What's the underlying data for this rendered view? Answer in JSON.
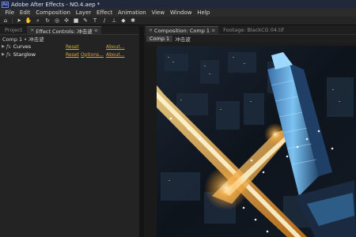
{
  "window": {
    "title": "Adobe After Effects - NO.4.aep *"
  },
  "menu": [
    "File",
    "Edit",
    "Composition",
    "Layer",
    "Effect",
    "Animation",
    "View",
    "Window",
    "Help"
  ],
  "tools": [
    "home-icon",
    "selection-icon",
    "hand-icon",
    "zoom-icon",
    "rotate-icon",
    "camera-icon",
    "pan-icon",
    "rectangle-icon",
    "pen-icon",
    "text-icon",
    "brush-icon",
    "stamp-icon",
    "eraser-icon",
    "puppet-icon"
  ],
  "left_panel": {
    "tabs": [
      {
        "label": "Project"
      },
      {
        "label": "Effect Controls: 冲击波"
      }
    ],
    "breadcrumb": "Comp 1 • 冲击波",
    "effects": [
      {
        "name": "Curves",
        "reset": "Reset",
        "about": "About..."
      },
      {
        "name": "Starglow",
        "reset": "Reset",
        "options": "Options...",
        "about": "About..."
      }
    ]
  },
  "right_panel": {
    "tabs": [
      {
        "label": "Composition: Comp 1"
      },
      {
        "label": "Footage: BlackCG 04.tif"
      }
    ],
    "breadcrumb": {
      "comp": "Comp 1",
      "layer": "冲击波"
    }
  },
  "colors": {
    "link": "#d9a640",
    "title_bar": "#20283a",
    "panel": "#232323"
  }
}
